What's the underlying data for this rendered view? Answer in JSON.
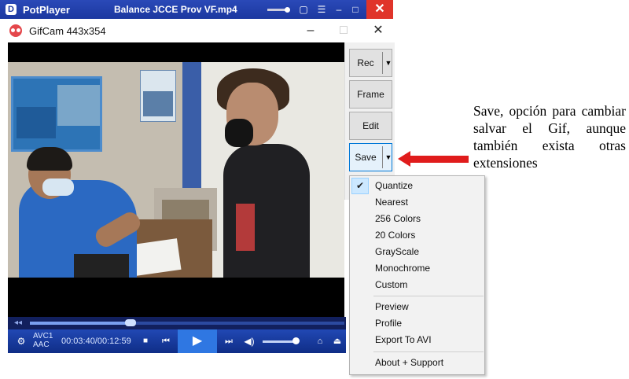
{
  "potplayer": {
    "title": "PotPlayer",
    "file": "Balance  JCCE Prov VF.mp4",
    "codec_line1": "AVC1",
    "codec_line2": "AAC",
    "time": "00:03:40/00:12:59",
    "seek_progress_fraction": 0.32
  },
  "gifcam": {
    "title": "GifCam 443x354",
    "buttons": {
      "rec": "Rec",
      "frame": "Frame",
      "edit": "Edit",
      "save": "Save"
    },
    "save_menu": {
      "items": [
        {
          "label": "Quantize",
          "checked": true
        },
        {
          "label": "Nearest"
        },
        {
          "label": "256 Colors"
        },
        {
          "label": "20 Colors"
        },
        {
          "label": "GrayScale"
        },
        {
          "label": "Monochrome"
        },
        {
          "label": "Custom"
        },
        {
          "label": "Preview"
        },
        {
          "label": "Profile"
        },
        {
          "label": "Export To AVI"
        },
        {
          "label": "About + Support"
        }
      ]
    }
  },
  "annotation": {
    "text": "Save, opción para cambiar salvar el Gif, aunque también exista otras extensiones",
    "arrow_color": "#e01c1c"
  },
  "colors": {
    "potplayer_titlebar": "#1c38a0",
    "close_red": "#e0342a",
    "menu_highlight": "#cce8ff"
  }
}
